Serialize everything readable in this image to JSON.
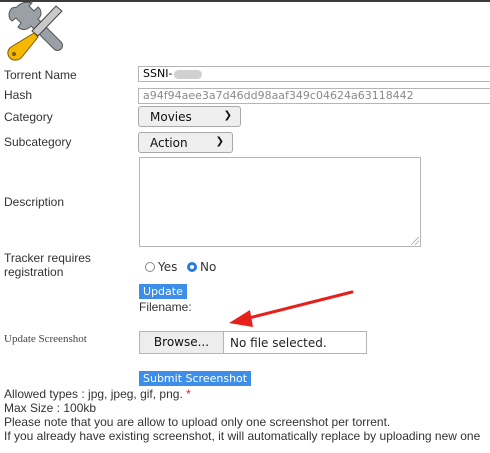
{
  "labels": {
    "torrent_name": "Torrent Name",
    "hash": "Hash",
    "category": "Category",
    "subcategory": "Subcategory",
    "description": "Description",
    "tracker_line1": "Tracker requires",
    "tracker_line2": "registration",
    "update_screenshot": "Update Screenshot",
    "filename": "Filename:"
  },
  "fields": {
    "torrent_name_value": "SSNI-",
    "hash_value": "a94f94aee3a7d46dd98aaf349c04624a63118442",
    "category_selected": "Movies",
    "subcategory_selected": "Action",
    "description_value": ""
  },
  "tracker": {
    "yes_label": "Yes",
    "no_label": "No",
    "selected": "No"
  },
  "buttons": {
    "update": "Update",
    "browse": "Browse...",
    "no_file": "No file selected.",
    "submit_screenshot": "Submit Screenshot"
  },
  "notes": {
    "allowed_types": "Allowed types : jpg, jpeg, gif, png.",
    "required_mark": "*",
    "max_size": "Max Size : 100kb",
    "one_screenshot": "Please note that you are allow to upload only one screenshot per torrent.",
    "replace": "If you already have existing screenshot, it will automatically replace by uploading new one"
  },
  "icons": {
    "logo": "wrench-screwdriver-icon",
    "select_caret": "chevron-down-icon",
    "annotation": "red-arrow-icon"
  },
  "colors": {
    "button_blue": "#3d8ee8",
    "radio_selected": "#2a7ae2",
    "arrow_red": "#e8201c",
    "handle_yellow": "#f5b800"
  }
}
